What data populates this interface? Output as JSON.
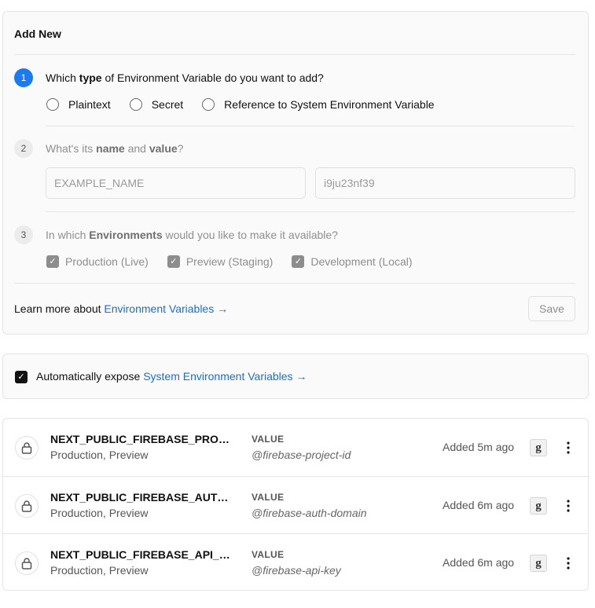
{
  "add_new": {
    "title": "Add New",
    "step1": {
      "num": "1",
      "q_pre": "Which ",
      "q_bold": "type",
      "q_post": " of Environment Variable do you want to add?",
      "options": [
        "Plaintext",
        "Secret",
        "Reference to System Environment Variable"
      ]
    },
    "step2": {
      "num": "2",
      "q_pre": "What's its ",
      "q_bold1": "name",
      "q_mid": " and ",
      "q_bold2": "value",
      "q_post": "?",
      "name_placeholder": "EXAMPLE_NAME",
      "value_placeholder": "i9ju23nf39"
    },
    "step3": {
      "num": "3",
      "q_pre": "In which ",
      "q_bold": "Environments",
      "q_post": " would you like to make it available?",
      "options": [
        "Production (Live)",
        "Preview (Staging)",
        "Development (Local)"
      ]
    },
    "learn_prefix": "Learn more about ",
    "learn_link": "Environment Variables →",
    "save_label": "Save"
  },
  "auto_expose": {
    "prefix": "Automatically expose ",
    "link": "System Environment Variables →",
    "checked": true
  },
  "env_vars": [
    {
      "name": "NEXT_PUBLIC_FIREBASE_PROJE…",
      "targets": "Production, Preview",
      "value_label": "VALUE",
      "value": "@firebase-project-id",
      "added": "Added 5m ago",
      "avatar": "g"
    },
    {
      "name": "NEXT_PUBLIC_FIREBASE_AUTH_…",
      "targets": "Production, Preview",
      "value_label": "VALUE",
      "value": "@firebase-auth-domain",
      "added": "Added 6m ago",
      "avatar": "g"
    },
    {
      "name": "NEXT_PUBLIC_FIREBASE_API_KEY",
      "targets": "Production, Preview",
      "value_label": "VALUE",
      "value": "@firebase-api-key",
      "added": "Added 6m ago",
      "avatar": "g"
    }
  ],
  "colors": {
    "accent": "#1a7bf0",
    "link": "#1a6dd6"
  },
  "icons": {
    "lock": "lock-icon",
    "menu": "more-vertical-icon",
    "check": "checkmark-icon"
  }
}
